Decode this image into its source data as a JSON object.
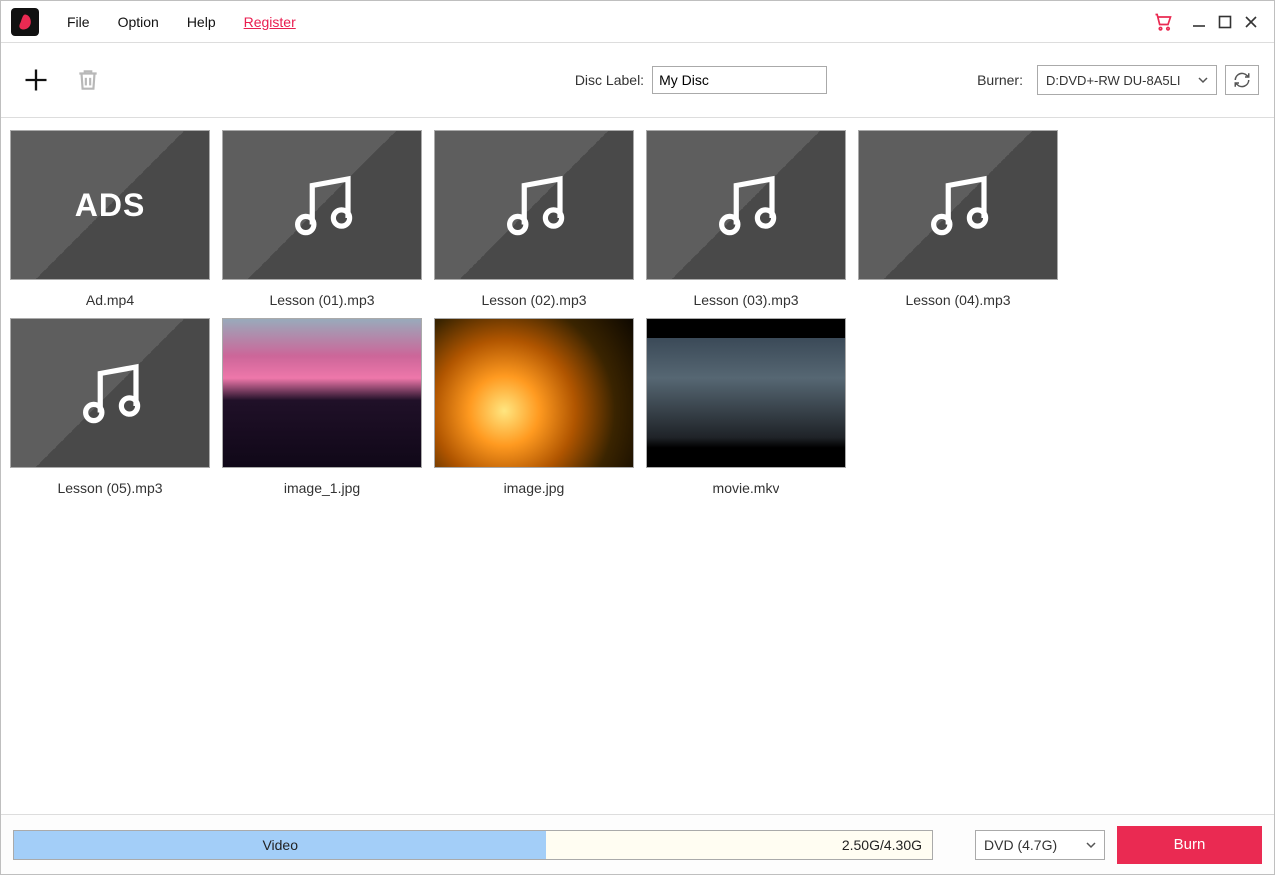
{
  "menu": {
    "file": "File",
    "option": "Option",
    "help": "Help",
    "register": "Register"
  },
  "toolbar": {
    "disc_label_label": "Disc Label:",
    "disc_label_value": "My Disc",
    "burner_label": "Burner:",
    "burner_value": "D:DVD+-RW DU-8A5LI"
  },
  "items": [
    {
      "type": "ads",
      "name": "Ad.mp4",
      "thumb_text": "ADS"
    },
    {
      "type": "audio",
      "name": "Lesson (01).mp3"
    },
    {
      "type": "audio",
      "name": "Lesson (02).mp3"
    },
    {
      "type": "audio",
      "name": "Lesson (03).mp3"
    },
    {
      "type": "audio",
      "name": "Lesson (04).mp3"
    },
    {
      "type": "audio",
      "name": "Lesson (05).mp3"
    },
    {
      "type": "image",
      "name": "image_1.jpg",
      "thumb_class": "thumb-img1"
    },
    {
      "type": "image",
      "name": "image.jpg",
      "thumb_class": "thumb-img2"
    },
    {
      "type": "video",
      "name": "movie.mkv",
      "thumb_class": "thumb-movie"
    }
  ],
  "footer": {
    "progress_label": "Video",
    "progress_used": "2.50G",
    "progress_total": "4.30G",
    "progress_percent": 58,
    "disc_type": "DVD (4.7G)",
    "burn_label": "Burn"
  },
  "colors": {
    "accent": "#ea2a52",
    "progress_fill": "#a3cef8"
  }
}
